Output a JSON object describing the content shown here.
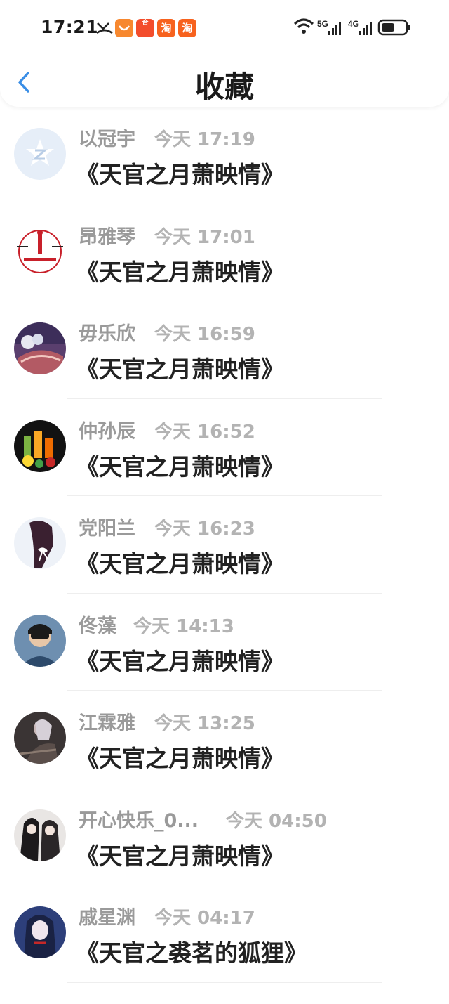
{
  "status_bar": {
    "time": "17:21",
    "app_badges": [
      "",
      "合",
      "淘",
      "淘"
    ],
    "network_5g": "5G",
    "network_4g": "4G"
  },
  "header": {
    "title": "收藏"
  },
  "favorites": [
    {
      "user": "以冠宇",
      "time": "今天 17:19",
      "title": "《天官之月萧映情》"
    },
    {
      "user": "昂雅琴",
      "time": "今天 17:01",
      "title": "《天官之月萧映情》"
    },
    {
      "user": "毋乐欣",
      "time": "今天 16:59",
      "title": "《天官之月萧映情》"
    },
    {
      "user": "仲孙辰",
      "time": "今天 16:52",
      "title": "《天官之月萧映情》"
    },
    {
      "user": "党阳兰",
      "time": "今天 16:23",
      "title": "《天官之月萧映情》"
    },
    {
      "user": "佟藻",
      "time": "今天 14:13",
      "title": "《天官之月萧映情》"
    },
    {
      "user": "江霖雅",
      "time": "今天 13:25",
      "title": "《天官之月萧映情》"
    },
    {
      "user": "开心快乐_0...",
      "time": "今天 04:50",
      "title": "《天官之月萧映情》"
    },
    {
      "user": "戚星渊",
      "time": "今天 04:17",
      "title": "《天官之裘茗的狐狸》"
    }
  ],
  "colors": {
    "accent": "#3a8ee6",
    "meta": "#9a9a9a",
    "text": "#222222"
  }
}
